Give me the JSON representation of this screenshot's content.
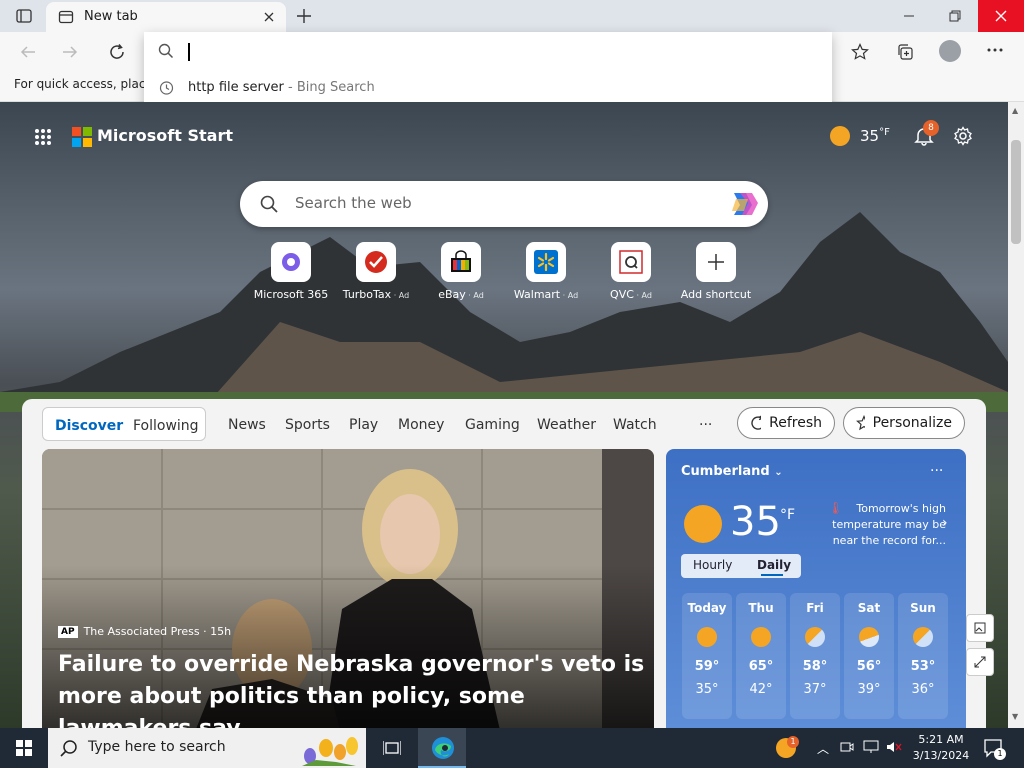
{
  "browser": {
    "tab_title": "New tab",
    "favorites_bar_text": "For quick access, place y",
    "omnibox": {
      "value": "",
      "suggestion_text": "http file server",
      "suggestion_source": " - Bing Search"
    }
  },
  "header": {
    "brand": "Microsoft Start",
    "weather_temp": "35",
    "weather_unit": "°F",
    "notification_count": "8"
  },
  "search": {
    "placeholder": "Search the web"
  },
  "shortcuts": [
    {
      "label": "Microsoft 365",
      "ad": ""
    },
    {
      "label": "TurboTax",
      "ad": " · Ad"
    },
    {
      "label": "eBay",
      "ad": " · Ad"
    },
    {
      "label": "Walmart",
      "ad": " · Ad"
    },
    {
      "label": "QVC",
      "ad": " · Ad"
    },
    {
      "label": "Add shortcut",
      "ad": ""
    }
  ],
  "feed_nav": {
    "discover": "Discover",
    "following": "Following",
    "items": [
      "News",
      "Sports",
      "Play",
      "Money",
      "Gaming",
      "Weather",
      "Watch"
    ],
    "more": "···",
    "refresh": "Refresh",
    "personalize": "Personalize"
  },
  "hero": {
    "source_logo": "AP",
    "source": "The Associated Press · 15h",
    "headline": "Failure to override Nebraska governor's veto is more about politics than policy, some lawmakers say"
  },
  "weather": {
    "location": "Cumberland",
    "temp": "35",
    "unit": "°F",
    "note": "Tomorrow's high temperature may be near the record for...",
    "tab_hourly": "Hourly",
    "tab_daily": "Daily",
    "days": [
      {
        "name": "Today",
        "high": "59°",
        "low": "35°"
      },
      {
        "name": "Thu",
        "high": "65°",
        "low": "42°"
      },
      {
        "name": "Fri",
        "high": "58°",
        "low": "37°"
      },
      {
        "name": "Sat",
        "high": "56°",
        "low": "39°"
      },
      {
        "name": "Sun",
        "high": "53°",
        "low": "36°"
      }
    ]
  },
  "taskbar": {
    "search_placeholder": "Type here to search",
    "time": "5:21 AM",
    "date": "3/13/2024",
    "notif_badge": "1",
    "action_center_count": "1"
  },
  "colors": {
    "accent": "#0067c0",
    "close_hover": "#e81123"
  }
}
